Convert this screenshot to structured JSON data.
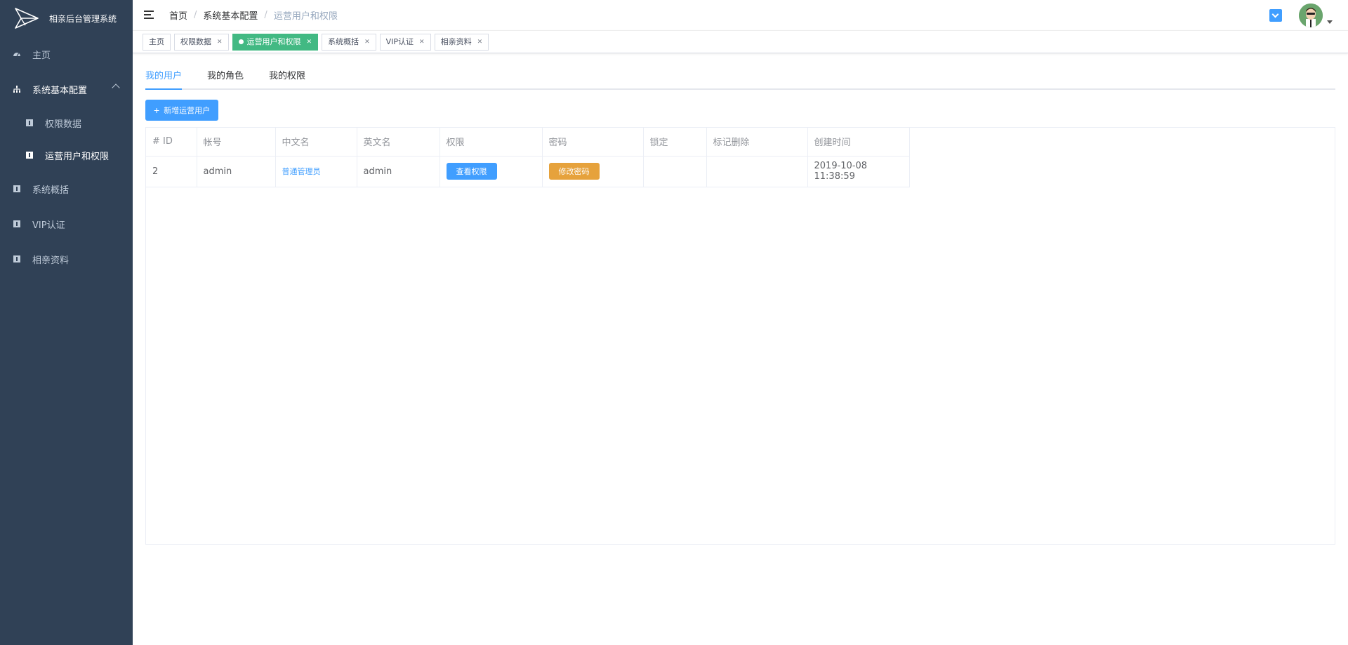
{
  "app": {
    "title": "相亲后台管理系统"
  },
  "sidebar": {
    "items": [
      {
        "label": "主页",
        "icon": "dashboard-icon"
      },
      {
        "label": "系统基本配置",
        "icon": "sitemap-icon",
        "expanded": true
      },
      {
        "label": "权限数据",
        "icon": "doc-icon"
      },
      {
        "label": "运营用户和权限",
        "icon": "doc-icon",
        "active": true
      },
      {
        "label": "系统概括",
        "icon": "doc-icon"
      },
      {
        "label": "VIP认证",
        "icon": "doc-icon"
      },
      {
        "label": "相亲资料",
        "icon": "doc-icon"
      }
    ]
  },
  "breadcrumb": [
    "首页",
    "系统基本配置",
    "运营用户和权限"
  ],
  "tags": [
    {
      "label": "主页",
      "closable": false
    },
    {
      "label": "权限数据",
      "closable": true
    },
    {
      "label": "运营用户和权限",
      "closable": true,
      "active": true
    },
    {
      "label": "系统概括",
      "closable": true
    },
    {
      "label": "VIP认证",
      "closable": true
    },
    {
      "label": "相亲资料",
      "closable": true
    }
  ],
  "subtabs": [
    "我的用户",
    "我的角色",
    "我的权限"
  ],
  "add_button": "新增运营用户",
  "table": {
    "headers": [
      "# ID",
      "帐号",
      "中文名",
      "英文名",
      "权限",
      "密码",
      "锁定",
      "标记删除",
      "创建时间"
    ],
    "rows": [
      {
        "id": "2",
        "account": "admin",
        "cn_name": "普通管理员",
        "en_name": "admin",
        "perm_button": "查看权限",
        "pwd_button": "修改密码",
        "locked": "",
        "deleted": "",
        "created": "2019-10-08 11:38:59"
      }
    ]
  },
  "colors": {
    "sidebar_bg": "#304156",
    "primary": "#409eff",
    "success": "#42b983",
    "warning": "#e6a23c"
  }
}
